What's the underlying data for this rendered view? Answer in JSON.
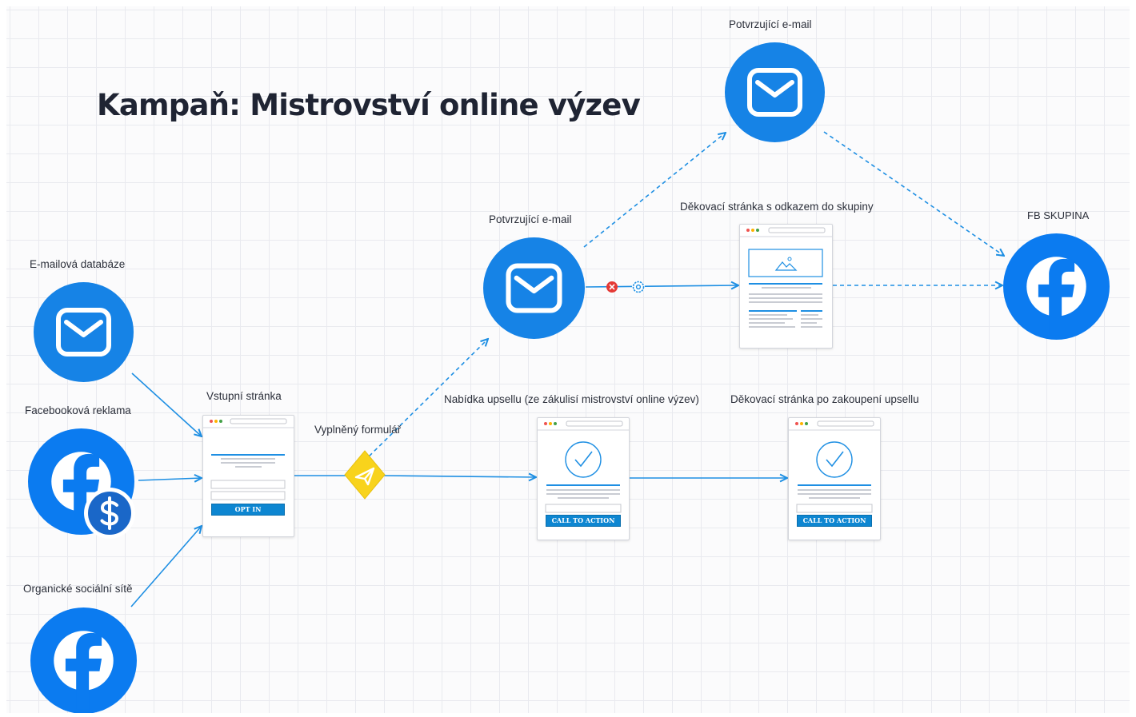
{
  "title": "Kampaň: Mistrovství online výzev",
  "labels": {
    "email_db": "E-mailová databáze",
    "fb_ads": "Facebooková reklama",
    "organic": "Organické sociální sítě",
    "landing": "Vstupní stránka",
    "form": "Vyplněný formulář",
    "confirm_email_mid": "Potvrzující e-mail",
    "confirm_email_top": "Potvrzující e-mail",
    "thank_you_group": "Děkovací stránka s odkazem do skupiny",
    "fb_group": "FB SKUPINA",
    "upsell": "Nabídka upsellu (ze zákulisí mistrovství online výzev)",
    "upsell_thanks": "Děkovací stránka po zakoupení upsellu"
  },
  "buttons": {
    "opt_in": "OPT IN",
    "cta_upsell": "CALL TO ACTION",
    "cta_thanks": "CALL TO ACTION"
  },
  "icons": {
    "email_db": "envelope-icon",
    "fb_ads": "facebook-icon",
    "fb_ads_badge": "dollar-icon",
    "organic": "facebook-icon",
    "form": "paper-plane-icon",
    "confirm_email_mid": "envelope-icon",
    "confirm_email_top": "envelope-icon",
    "fb_group": "facebook-icon",
    "error_marker": "x-circle-icon",
    "settings_marker": "gear-icon"
  },
  "colors": {
    "accent": "#1683e6",
    "facebook": "#0b7bf0",
    "form_diamond": "#f8d31c",
    "error": "#e53935",
    "title": "#1f2433"
  }
}
